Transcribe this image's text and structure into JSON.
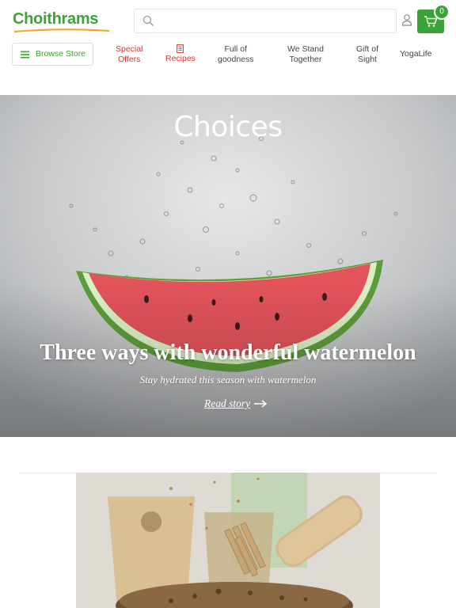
{
  "header": {
    "logo_text": "Choithrams",
    "search": {
      "placeholder": "",
      "value": ""
    },
    "cart": {
      "count": "0"
    },
    "browse_label": "Browse Store",
    "nav": [
      {
        "line1": "Special",
        "line2": "Offers"
      },
      {
        "label": "Recipes"
      },
      {
        "line1": "Full of",
        "line2": "goodness"
      },
      {
        "line1": "We Stand",
        "line2": "Together"
      },
      {
        "line1": "Gift of",
        "line2": "Sight"
      },
      {
        "label": "YogaLife"
      }
    ]
  },
  "hero": {
    "heading": "Choices",
    "title": "Three ways with wonderful watermelon",
    "subtitle": "Stay hydrated this season with watermelon",
    "link_label": "Read story"
  },
  "colors": {
    "brand_green": "#3aa335",
    "nav_red": "#e0312f",
    "logo_swoosh_orange": "#f2a31b"
  },
  "icons": [
    "search-icon",
    "user-icon",
    "cart-icon",
    "menu-icon",
    "recipe-book-icon",
    "arrow-right-icon"
  ]
}
